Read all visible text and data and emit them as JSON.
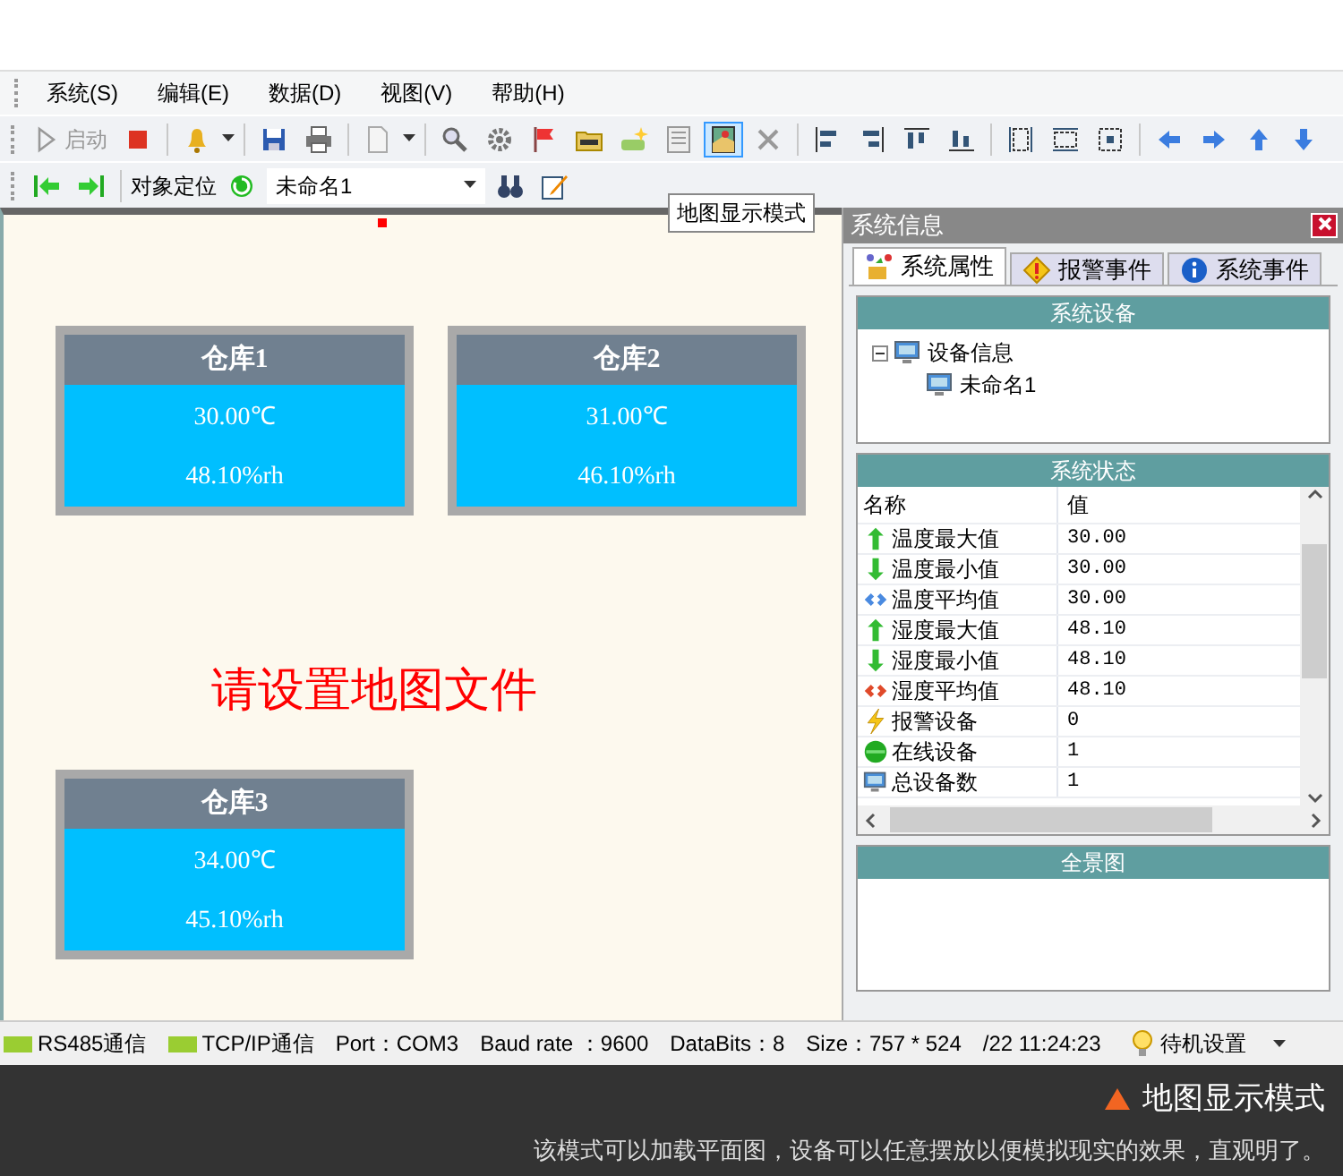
{
  "menu": [
    {
      "label": "系统(S)"
    },
    {
      "label": "编辑(E)"
    },
    {
      "label": "数据(D)"
    },
    {
      "label": "视图(V)"
    },
    {
      "label": "帮助(H)"
    }
  ],
  "toolbar": {
    "start_label": "启动",
    "start_disabled": true,
    "map_mode_selected": true,
    "delete_disabled": true
  },
  "locator": {
    "label": "对象定位",
    "combo_value": "未命名1"
  },
  "tooltip": "地图显示模式",
  "map": {
    "message": "请设置地图文件",
    "warehouses": [
      {
        "name": "仓库1",
        "temperature": "30.00℃",
        "humidity": "48.10%rh"
      },
      {
        "name": "仓库2",
        "temperature": "31.00℃",
        "humidity": "46.10%rh"
      },
      {
        "name": "仓库3",
        "temperature": "34.00℃",
        "humidity": "45.10%rh"
      }
    ]
  },
  "panel": {
    "title": "系统信息",
    "tabs": [
      {
        "label": "系统属性",
        "selected": true,
        "kind": "props"
      },
      {
        "label": "报警事件",
        "selected": false,
        "kind": "alarm"
      },
      {
        "label": "系统事件",
        "selected": false,
        "kind": "info"
      }
    ],
    "devices": {
      "header": "系统设备",
      "tree": [
        {
          "label": "设备信息",
          "expanded": true,
          "children": [
            {
              "label": "未命名1"
            }
          ]
        }
      ]
    },
    "status": {
      "header": "系统状态",
      "columns": [
        "名称",
        "值"
      ],
      "rows": [
        {
          "kind": "up",
          "name": "温度最大值",
          "value": "30.00"
        },
        {
          "kind": "down",
          "name": "温度最小值",
          "value": "30.00"
        },
        {
          "kind": "avg-blue",
          "name": "温度平均值",
          "value": "30.00"
        },
        {
          "kind": "up",
          "name": "湿度最大值",
          "value": "48.10"
        },
        {
          "kind": "down",
          "name": "湿度最小值",
          "value": "48.10"
        },
        {
          "kind": "avg-red",
          "name": "湿度平均值",
          "value": "48.10"
        },
        {
          "kind": "alarm",
          "name": "报警设备",
          "value": "0"
        },
        {
          "kind": "online",
          "name": "在线设备",
          "value": "1"
        },
        {
          "kind": "total",
          "name": "总设备数",
          "value": "1"
        }
      ]
    },
    "panorama": {
      "header": "全景图"
    }
  },
  "status_bar": {
    "indicators": [
      {
        "label": "RS485通信",
        "on": true
      },
      {
        "label": "TCP/IP通信",
        "on": true
      }
    ],
    "fields": [
      "Port：COM3",
      "Baud rate ：9600",
      "DataBits：8",
      "Size：757 * 524",
      "/22 11:24:23"
    ],
    "mode": "待机设置"
  },
  "caption": {
    "title": "地图显示模式",
    "text": "该模式可以加载平面图，设备可以任意摆放以便模拟现实的效果，直观明了。"
  }
}
